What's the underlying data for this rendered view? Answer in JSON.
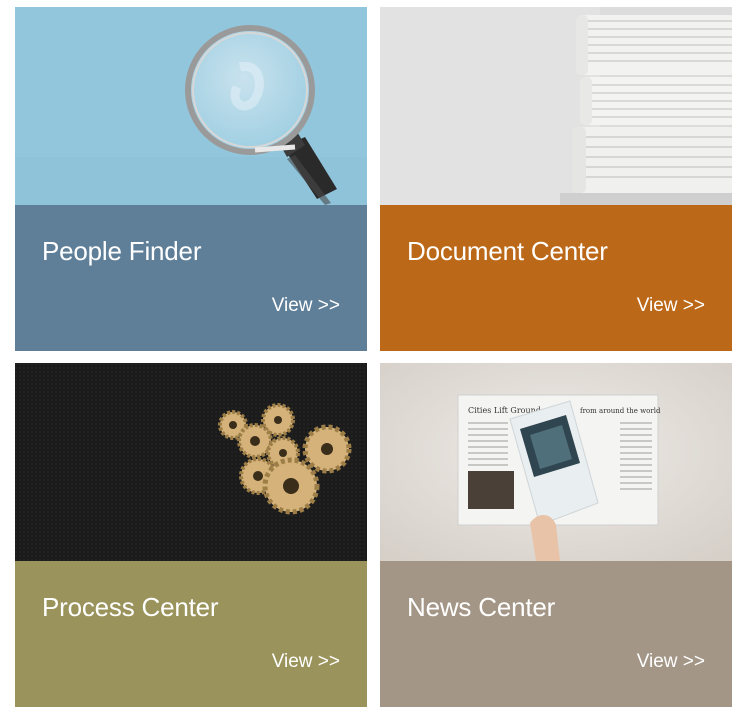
{
  "tiles": [
    {
      "title": "People Finder",
      "link": "View >>",
      "color": "#5f7f99",
      "image": "magnifying-glass-photo"
    },
    {
      "title": "Document Center",
      "link": "View >>",
      "color": "#bb6918",
      "image": "binders-photo"
    },
    {
      "title": "Process Center",
      "link": "View >>",
      "color": "#9a935b",
      "image": "gears-photo"
    },
    {
      "title": "News Center",
      "link": "View >>",
      "color": "#a39686",
      "image": "newspaper-photo"
    }
  ],
  "newspaper": {
    "headline_left": "Cities Lift Ground",
    "headline_right": "from around the world"
  }
}
